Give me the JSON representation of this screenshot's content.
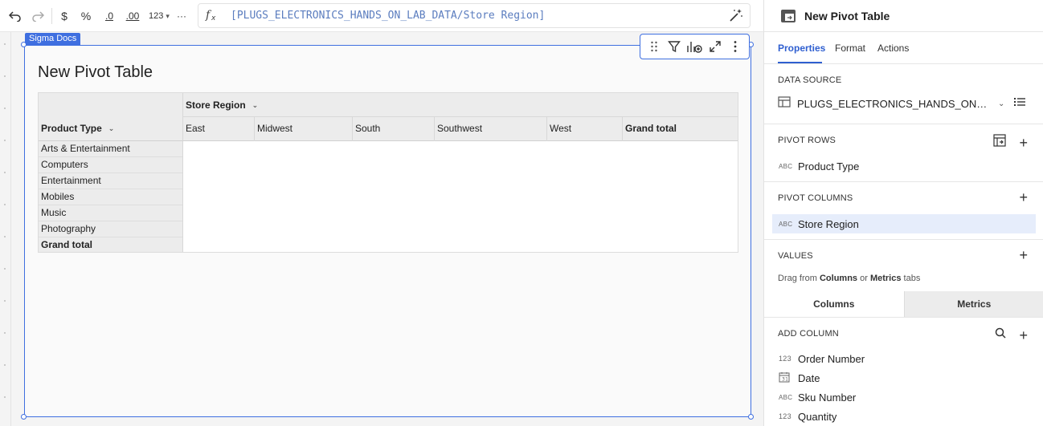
{
  "formula": {
    "expression": "[PLUGS_ELECTRONICS_HANDS_ON_LAB_DATA/Store Region]"
  },
  "toolbar": {
    "currency": "$",
    "percent": "%",
    "decrease_decimals": ".0",
    "increase_decimals": ".00",
    "number_format": "123",
    "more": "···",
    "fx": "fx"
  },
  "element": {
    "tag": "Sigma Docs",
    "title": "New Pivot Table"
  },
  "pivot": {
    "column_header": "Store Region",
    "row_header": "Product Type",
    "columns": [
      "East",
      "Midwest",
      "South",
      "Southwest",
      "West",
      "Grand total"
    ],
    "rows": [
      "Arts & Entertainment",
      "Computers",
      "Entertainment",
      "Mobiles",
      "Music",
      "Photography",
      "Grand total"
    ]
  },
  "panel": {
    "title": "New Pivot Table",
    "tabs": [
      "Properties",
      "Format",
      "Actions"
    ],
    "data_source": {
      "label": "DATA SOURCE",
      "name": "PLUGS_ELECTRONICS_HANDS_ON_LAB_DATA"
    },
    "pivot_rows": {
      "label": "PIVOT ROWS",
      "items": [
        {
          "type": "ABC",
          "name": "Product Type"
        }
      ]
    },
    "pivot_columns": {
      "label": "PIVOT COLUMNS",
      "items": [
        {
          "type": "ABC",
          "name": "Store Region"
        }
      ]
    },
    "values": {
      "label": "VALUES",
      "hint_pre": "Drag from ",
      "hint_columns": "Columns",
      "hint_mid": " or ",
      "hint_metrics": "Metrics",
      "hint_post": " tabs"
    },
    "segments": [
      "Columns",
      "Metrics"
    ],
    "add_column": {
      "label": "ADD COLUMN",
      "items": [
        {
          "type": "123",
          "name": "Order Number"
        },
        {
          "type": "date",
          "name": "Date"
        },
        {
          "type": "ABC",
          "name": "Sku Number"
        },
        {
          "type": "123",
          "name": "Quantity"
        }
      ]
    }
  },
  "colors": {
    "accent": "#3f6fe0",
    "tab_active": "#2f5fd0",
    "selected_row": "#e6edfb",
    "formula_text": "#5b7dbf"
  }
}
